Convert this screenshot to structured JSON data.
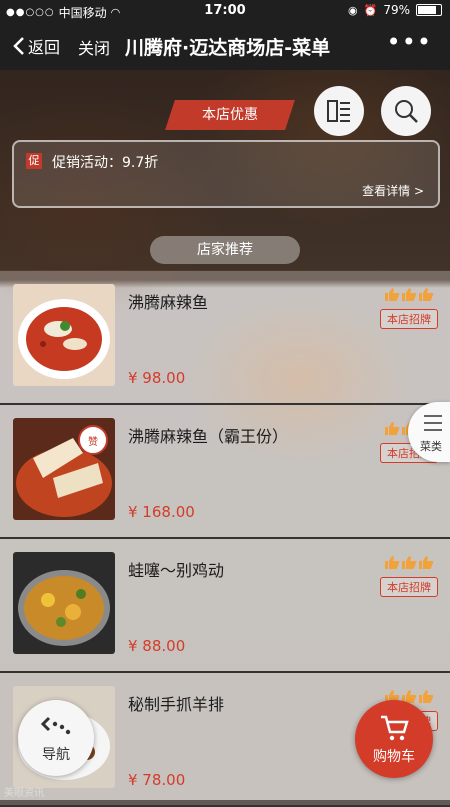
{
  "status": {
    "carrier": "中国移动",
    "time": "17:00",
    "battery": "79%"
  },
  "nav": {
    "back": "返回",
    "close": "关闭",
    "title": "川腾府·迈达商场店-菜单"
  },
  "header": {
    "promo_tag": "本店优惠",
    "promo_badge": "促",
    "promo_text": "促销活动：9.7折",
    "promo_detail": "查看详情 >",
    "recommend": "店家推荐"
  },
  "items": [
    {
      "name": "沸腾麻辣鱼",
      "price": "¥ 98.00",
      "sign": "本店招牌",
      "rating": 3,
      "thumb": "red-fish"
    },
    {
      "name": "沸腾麻辣鱼（霸王份）",
      "price": "¥ 168.00",
      "sign": "本店招牌",
      "rating": 3,
      "thumb": "fish-slices"
    },
    {
      "name": "蛙噻～别鸡动",
      "price": "¥ 88.00",
      "sign": "本店招牌",
      "rating": 3,
      "thumb": "chicken-pot"
    },
    {
      "name": "秘制手抓羊排",
      "price": "¥ 78.00",
      "sign": "本店招牌",
      "rating": 3,
      "thumb": "lamb-ribs"
    }
  ],
  "sidetab": {
    "label": "菜类"
  },
  "floating": {
    "nav_label": "导航",
    "cart_label": "购物车"
  },
  "watermark": "美眼资讯",
  "icons": {
    "list": "list-icon",
    "search": "search-icon",
    "thumb": "thumbs-up-icon",
    "cart": "cart-icon",
    "nav": "dots-arrow-icon"
  },
  "colors": {
    "accent": "#d43c2a",
    "bar": "#1f1f1f",
    "rating": "#f2a23a"
  }
}
